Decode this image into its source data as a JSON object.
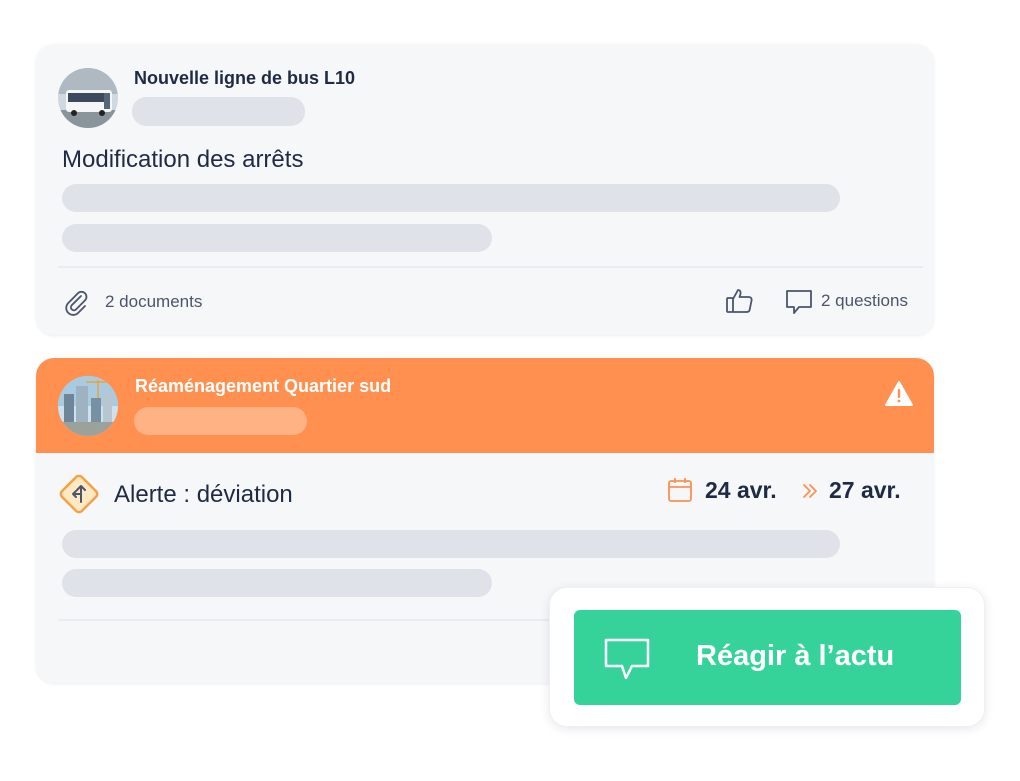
{
  "posts": [
    {
      "title": "Nouvelle ligne de bus L10",
      "heading": "Modification des arrêts",
      "documents_label": "2 documents",
      "questions_label": "2 questions",
      "avatar_icon": "bus-photo"
    },
    {
      "title": "Réaménagement Quartier sud",
      "heading": "Alerte : déviation",
      "date_start": "24 avr.",
      "date_end": "27 avr.",
      "avatar_icon": "construction-photo",
      "banner_color": "#ff9050"
    }
  ],
  "cta": {
    "label": "Réagir à l’actu",
    "color": "#35d39a"
  },
  "icons": {
    "attachment": "paperclip-icon",
    "like": "thumbs-up-icon",
    "comment": "speech-bubble-icon",
    "warning": "warning-triangle-icon",
    "calendar": "calendar-icon",
    "arrow": "double-chevron-right-icon",
    "alert": "detour-sign-icon"
  }
}
